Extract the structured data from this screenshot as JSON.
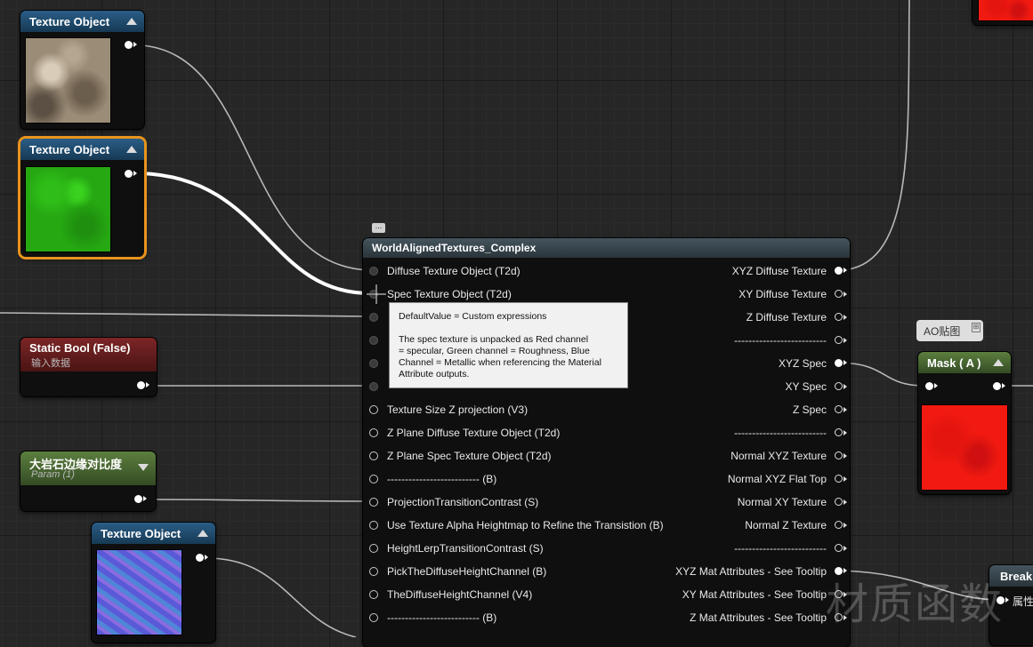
{
  "nodes": {
    "texture1": {
      "title": "Texture Object"
    },
    "texture2": {
      "title": "Texture Object"
    },
    "texture3": {
      "title": "Texture Object"
    },
    "static_bool": {
      "title": "Static Bool (False)",
      "subtitle": "输入数据"
    },
    "param": {
      "title": "大岩石边缘对比度",
      "subtitle": "Param (1)"
    },
    "mask": {
      "title": "Mask ( A )"
    },
    "break": {
      "title": "Break",
      "pin_label": "属性"
    }
  },
  "main_node": {
    "title": "WorldAlignedTextures_Complex",
    "inputs": [
      "Diffuse Texture Object (T2d)",
      "Spec Texture Object (T2d)",
      "",
      "",
      "",
      "",
      "Texture Size Z projection (V3)",
      "Z Plane Diffuse Texture Object (T2d)",
      "Z Plane Spec Texture Object (T2d)",
      "--------------------------          (B)",
      "ProjectionTransitionContrast (S)",
      "Use Texture Alpha Heightmap to Refine the Transistion (B)",
      "HeightLerpTransitionContrast (S)",
      "PickTheDiffuseHeightChannel (B)",
      "TheDiffuseHeightChannel (V4)",
      "--------------------------          (B)"
    ],
    "outputs": [
      "XYZ Diffuse Texture",
      "XY Diffuse Texture",
      "Z Diffuse Texture",
      "--------------------------",
      "XYZ Spec",
      "XY Spec",
      "Z Spec",
      "--------------------------",
      "Normal XYZ Texture",
      "Normal XYZ Flat Top",
      "Normal XY Texture",
      "Normal Z Texture",
      "--------------------------",
      "XYZ Mat Attributes - See Tooltip",
      "XY Mat Attributes - See Tooltip",
      "Z Mat Attributes - See Tooltip"
    ]
  },
  "tooltip": {
    "line1": "DefaultValue = Custom expressions",
    "line2": "The spec texture is unpacked as Red channel",
    "line3": "= specular, Green channel = Roughness, Blue",
    "line4": "Channel = Metallic when referencing the Material",
    "line5": "Attribute outputs."
  },
  "comment": {
    "label": "AO贴图"
  },
  "watermark": {
    "text": "材质函数"
  },
  "colors": {
    "selection": "#e8931e",
    "header_blue": "#2a5d86",
    "header_red": "#7c2526",
    "header_green": "#5c7f3f",
    "wire": "#c8c8c8"
  }
}
